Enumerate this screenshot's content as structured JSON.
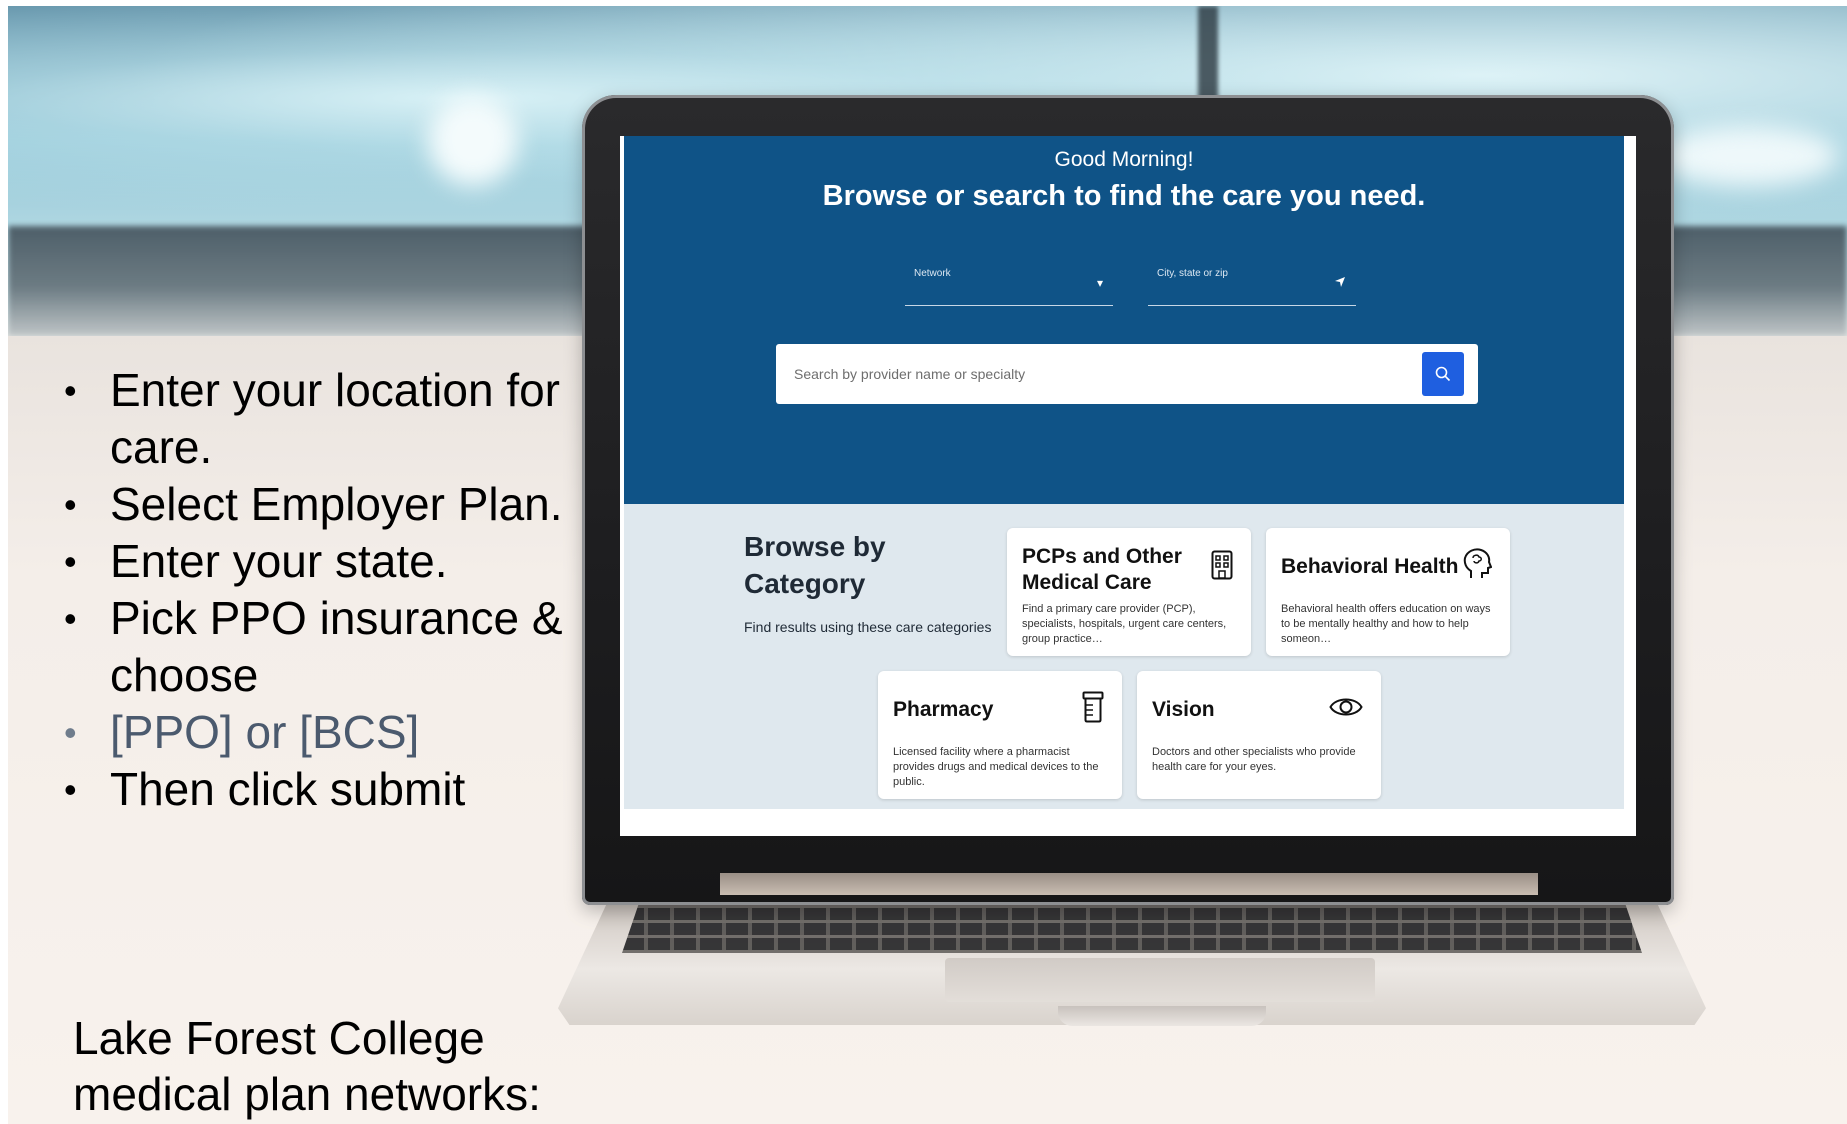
{
  "bullets": [
    "Enter your location for care.",
    "Select Employer Plan.",
    "Enter your state.",
    "Pick PPO insurance & choose",
    "[PPO] or [BCS]",
    "Then click submit"
  ],
  "footer": "Lake Forest College medical plan networks:",
  "app": {
    "greeting": "Good Morning!",
    "headline": "Browse or search to find the care you need.",
    "network_label": "Network",
    "location_label": "City, state or zip",
    "search_placeholder": "Search by provider name or specialty",
    "browse_title": "Browse by Category",
    "browse_subtitle": "Find results using these care categories",
    "cards": [
      {
        "title": "PCPs and Other Medical Care",
        "desc": "Find a primary care provider (PCP), specialists, hospitals, urgent care centers, group practice…",
        "icon": "building-icon"
      },
      {
        "title": "Behavioral Health",
        "desc": "Behavioral health offers education on ways to be mentally healthy and how to help someon…",
        "icon": "brain-head-icon"
      },
      {
        "title": "Pharmacy",
        "desc": "Licensed facility where a pharmacist provides drugs and medical devices to the public.",
        "icon": "pill-bottle-icon"
      },
      {
        "title": "Vision",
        "desc": "Doctors and other specialists who provide health care for your eyes.",
        "icon": "eye-icon"
      }
    ]
  },
  "colors": {
    "hero_blue": "#0f5387",
    "browse_bg": "#dfe8ee",
    "search_button": "#1f5fe0"
  }
}
